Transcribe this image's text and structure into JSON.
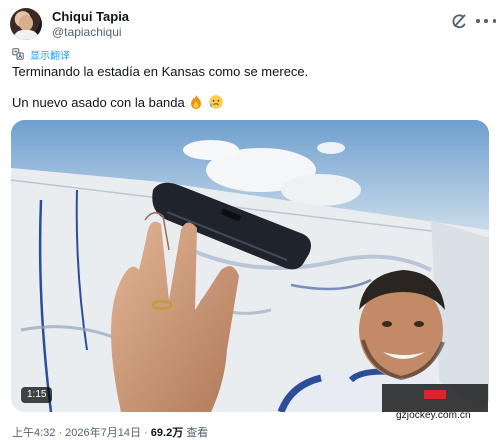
{
  "tweet": {
    "author": {
      "display_name": "Chiqui Tapia",
      "handle": "@tapiachiqui"
    },
    "translate_label": "显示翻译",
    "text_line_1": "Terminando la estadía en Kansas como se merece.",
    "text_line_2": "Un nuevo asado con la banda",
    "emojis": [
      "fire",
      "face-holding-back-tears"
    ],
    "video": {
      "duration": "1:15"
    },
    "timestamp": "上午4:32 · 2026年7月14日",
    "separator": " · ",
    "views_count": "69.2万",
    "views_label": "查看"
  },
  "watermark": {
    "url": "gzjockey.com.cn"
  },
  "colors": {
    "link": "#1d9bf0",
    "muted": "#536471",
    "text": "#0f1419"
  },
  "icons": [
    "grok-icon",
    "more-icon",
    "translate-icon"
  ]
}
